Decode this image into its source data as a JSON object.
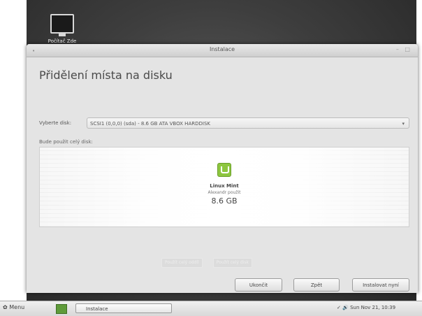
{
  "desktop": {
    "icon_label": "Počítač Zde"
  },
  "window": {
    "title": "Instalace",
    "controls": "– □",
    "heading": "Přidělení místa na disku",
    "disk_label": "Vyberte disk:",
    "disk_value": "SCSI1 (0,0,0) (sda) - 8.6 GB ATA VBOX HARDDISK",
    "whole_disk_label": "Bude použit celý disk:",
    "os_name": "Linux Mint",
    "os_sub": "Alexandr použit",
    "os_size": "8.6 GB",
    "ghost_buttons": [
      "Použít celý oddíl",
      "Použít celý disk"
    ],
    "buttons": {
      "quit": "Ukončit",
      "back": "Zpět",
      "install": "Instalovat nyní"
    }
  },
  "taskbar": {
    "menu": "Menu",
    "task": "Instalace",
    "tray": "Sun Nov 21, 10:39"
  }
}
